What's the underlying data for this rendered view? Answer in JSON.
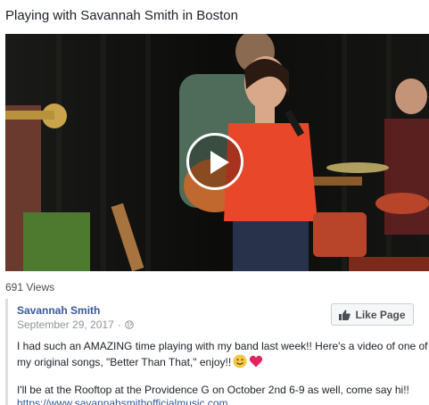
{
  "video": {
    "title": "Playing with Savannah Smith in Boston",
    "views": "691 Views",
    "play_icon": "play-icon"
  },
  "post": {
    "author": "Savannah Smith",
    "date": "September 29, 2017",
    "separator": "·",
    "privacy_icon": "globe-icon",
    "like_page_label": "Like Page",
    "like_icon": "thumbs-up-icon",
    "text_1": "I had such an AMAZING time playing with my band last week!! Here's a video of one of my original songs, \"Better Than That,\" enjoy!!",
    "emojis": [
      "smile-emoji",
      "heart-emoji"
    ],
    "text_2": "I'll be at the Rooftop at the Providence G on October 2nd 6-9 as well, come say hi!!",
    "link": "https://www.savannahsmithofficialmusic.com"
  },
  "colors": {
    "link_blue": "#365899",
    "dress_orange": "#e8472a",
    "heart_red": "#e0245e"
  }
}
